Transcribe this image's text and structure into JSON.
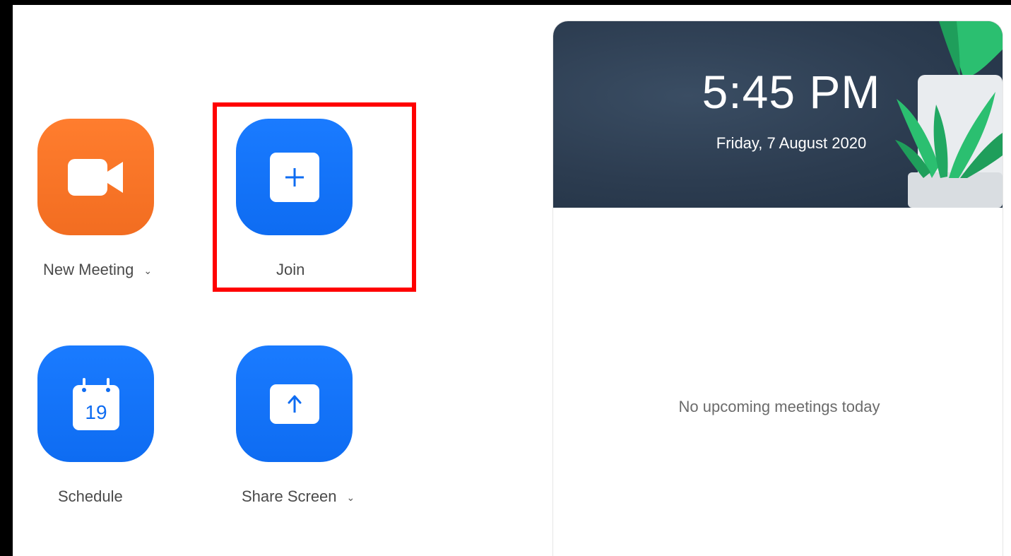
{
  "actions": {
    "new_meeting": {
      "label": "New Meeting",
      "has_dropdown": true,
      "icon": "video-camera-icon",
      "color": "#f26d21"
    },
    "join": {
      "label": "Join",
      "icon": "plus-icon",
      "color": "#0e6cf2"
    },
    "schedule": {
      "label": "Schedule",
      "icon": "calendar-icon",
      "day": "19",
      "color": "#0e6cf2"
    },
    "share_screen": {
      "label": "Share Screen",
      "has_dropdown": true,
      "icon": "upload-arrow-icon",
      "color": "#0e6cf2"
    }
  },
  "highlight": {
    "target": "join",
    "color": "#ff0000"
  },
  "panel": {
    "time": "5:45 PM",
    "date": "Friday, 7 August 2020",
    "empty_message": "No upcoming meetings today"
  }
}
